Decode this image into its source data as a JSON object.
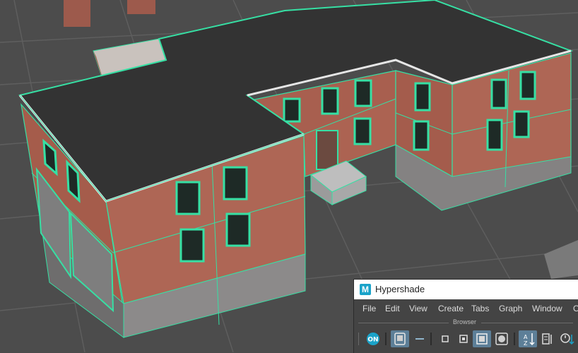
{
  "hypershade": {
    "title": "Hypershade",
    "logo_letter": "M",
    "menu": [
      "File",
      "Edit",
      "View",
      "Create",
      "Tabs",
      "Graph",
      "Window",
      "O"
    ],
    "browser_label": "Browser",
    "toolbar": {
      "on_label": "ON"
    }
  },
  "colors": {
    "wireframe": "#36e0a4",
    "brick": "#a85a4a",
    "roof": "#333333",
    "grid": "#5e5e5e",
    "accent": "#1aa3c9"
  }
}
